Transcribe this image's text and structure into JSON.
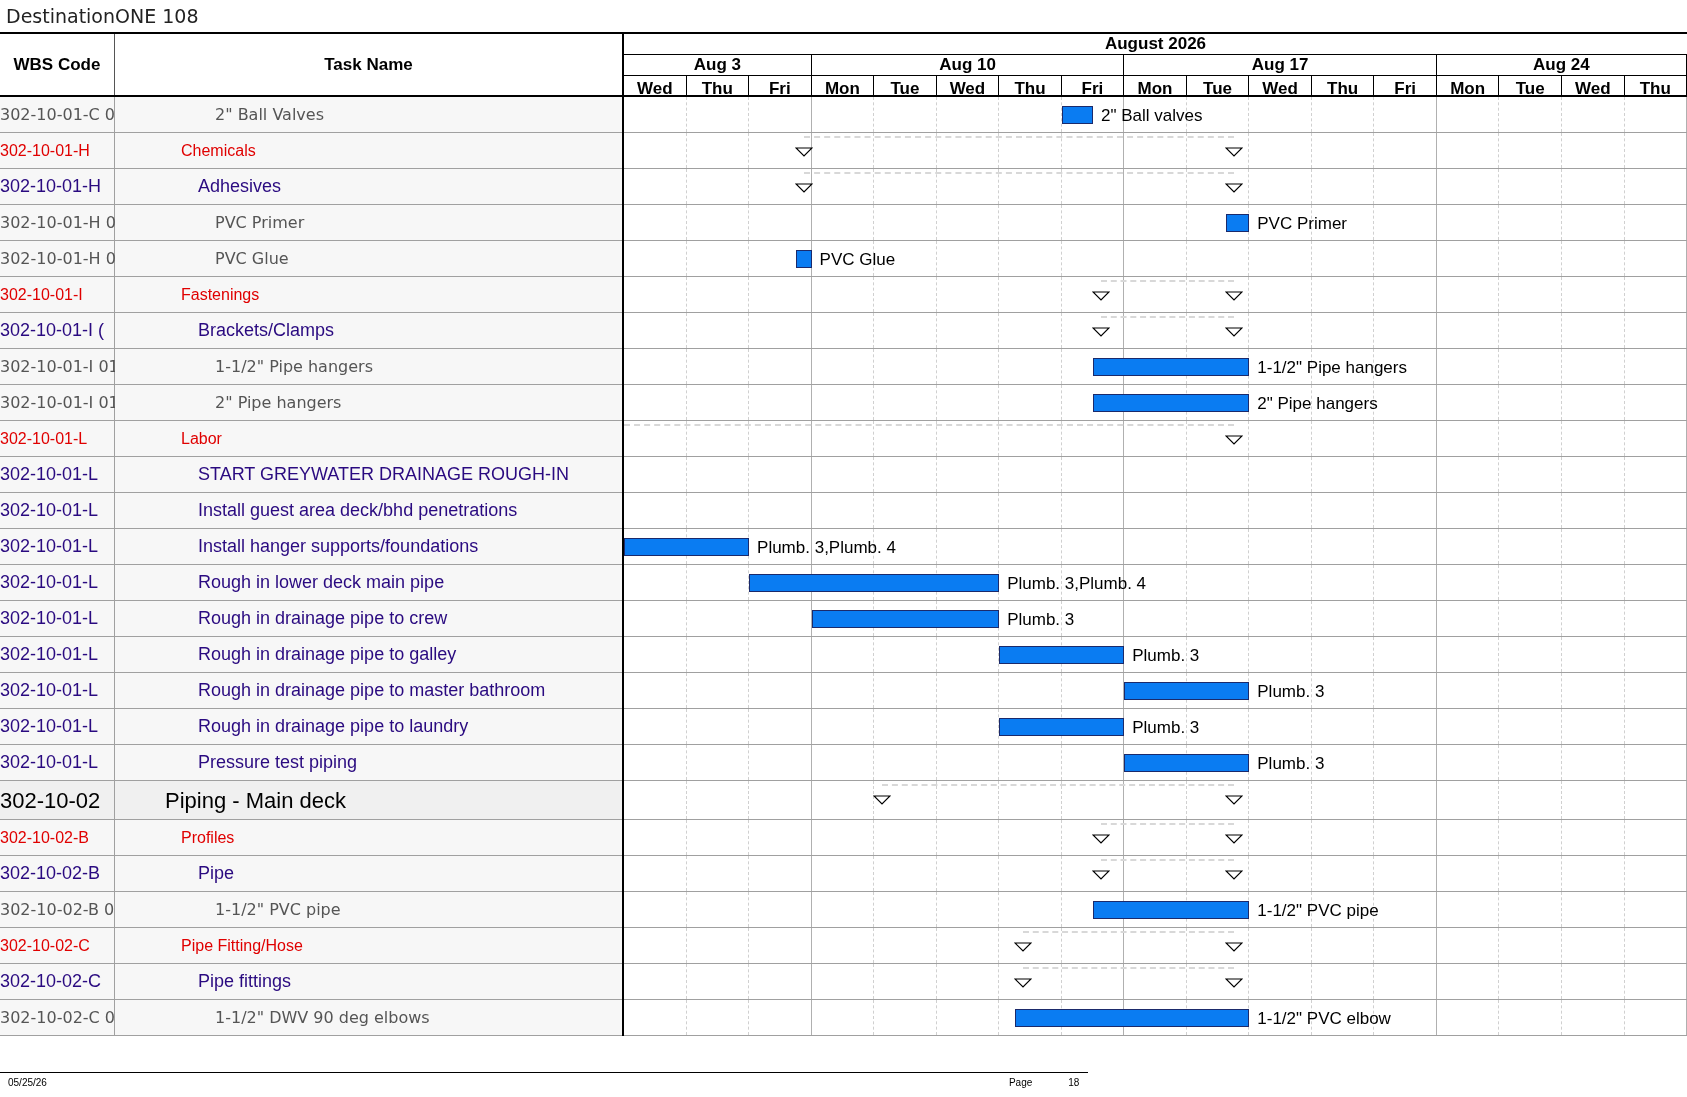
{
  "title": "DestinationONE 108",
  "columns": {
    "wbs": "WBS Code",
    "task": "Task Name"
  },
  "timescale": {
    "month": "August 2026",
    "weeks": [
      "Aug 3",
      "Aug 10",
      "Aug 17",
      "Aug 24"
    ],
    "days": [
      "Wed",
      "Thu",
      "Fri",
      "Mon",
      "Tue",
      "Wed",
      "Thu",
      "Fri",
      "Mon",
      "Tue",
      "Wed",
      "Thu",
      "Fri",
      "Mon",
      "Tue",
      "Wed",
      "Thu"
    ]
  },
  "rows": [
    {
      "wbs": "302-10-01-C 0",
      "task": "2\" Ball Valves",
      "kind": "item",
      "bar_label": "2\" Ball valves"
    },
    {
      "wbs": "302-10-01-H",
      "task": "Chemicals",
      "kind": "group"
    },
    {
      "wbs": "302-10-01-H",
      "task": "Adhesives",
      "kind": "subgroup"
    },
    {
      "wbs": "302-10-01-H 0",
      "task": "PVC Primer",
      "kind": "item",
      "bar_label": "PVC Primer"
    },
    {
      "wbs": "302-10-01-H 0",
      "task": "PVC Glue",
      "kind": "item",
      "bar_label": "PVC Glue"
    },
    {
      "wbs": "302-10-01-I",
      "task": "Fastenings",
      "kind": "group"
    },
    {
      "wbs": "302-10-01-I (",
      "task": "Brackets/Clamps",
      "kind": "subgroup"
    },
    {
      "wbs": "302-10-01-I 01",
      "task": "1-1/2\" Pipe hangers",
      "kind": "item",
      "bar_label": "1-1/2\" Pipe hangers"
    },
    {
      "wbs": "302-10-01-I 01",
      "task": "2\" Pipe hangers",
      "kind": "item",
      "bar_label": "2\" Pipe hangers"
    },
    {
      "wbs": "302-10-01-L",
      "task": "Labor",
      "kind": "group"
    },
    {
      "wbs": "302-10-01-L",
      "task": "START GREYWATER DRAINAGE ROUGH-IN",
      "kind": "subgroup"
    },
    {
      "wbs": "302-10-01-L",
      "task": "Install guest area deck/bhd penetrations",
      "kind": "subgroup"
    },
    {
      "wbs": "302-10-01-L",
      "task": "Install hanger supports/foundations",
      "kind": "subgroup",
      "bar_label": "Plumb. 3,Plumb. 4"
    },
    {
      "wbs": "302-10-01-L",
      "task": "Rough in lower deck main pipe",
      "kind": "subgroup",
      "bar_label": "Plumb. 3,Plumb. 4"
    },
    {
      "wbs": "302-10-01-L",
      "task": "Rough in drainage pipe to crew",
      "kind": "subgroup",
      "bar_label": "Plumb. 3"
    },
    {
      "wbs": "302-10-01-L",
      "task": "Rough in drainage pipe to galley",
      "kind": "subgroup",
      "bar_label": "Plumb. 3"
    },
    {
      "wbs": "302-10-01-L",
      "task": "Rough in drainage pipe to master bathroom",
      "kind": "subgroup",
      "bar_label": "Plumb. 3"
    },
    {
      "wbs": "302-10-01-L",
      "task": "Rough in drainage pipe to laundry",
      "kind": "subgroup",
      "bar_label": "Plumb. 3"
    },
    {
      "wbs": "302-10-01-L",
      "task": "Pressure test piping",
      "kind": "subgroup",
      "bar_label": "Plumb. 3"
    },
    {
      "wbs": "302-10-02",
      "task": "Piping - Main deck",
      "kind": "section"
    },
    {
      "wbs": "302-10-02-B",
      "task": "Profiles",
      "kind": "group"
    },
    {
      "wbs": "302-10-02-B",
      "task": "Pipe",
      "kind": "subgroup"
    },
    {
      "wbs": "302-10-02-B 0",
      "task": "1-1/2\" PVC pipe",
      "kind": "item",
      "bar_label": "1-1/2\" PVC pipe"
    },
    {
      "wbs": "302-10-02-C",
      "task": "Pipe Fitting/Hose",
      "kind": "group"
    },
    {
      "wbs": "302-10-02-C",
      "task": "Pipe fittings",
      "kind": "subgroup"
    },
    {
      "wbs": "302-10-02-C 0",
      "task": "1-1/2\" DWV 90 deg elbows",
      "kind": "item",
      "bar_label": "1-1/2\" PVC elbow"
    }
  ],
  "footer": {
    "date": "05/25/26",
    "page_label": "Page",
    "page_number": "18"
  }
}
